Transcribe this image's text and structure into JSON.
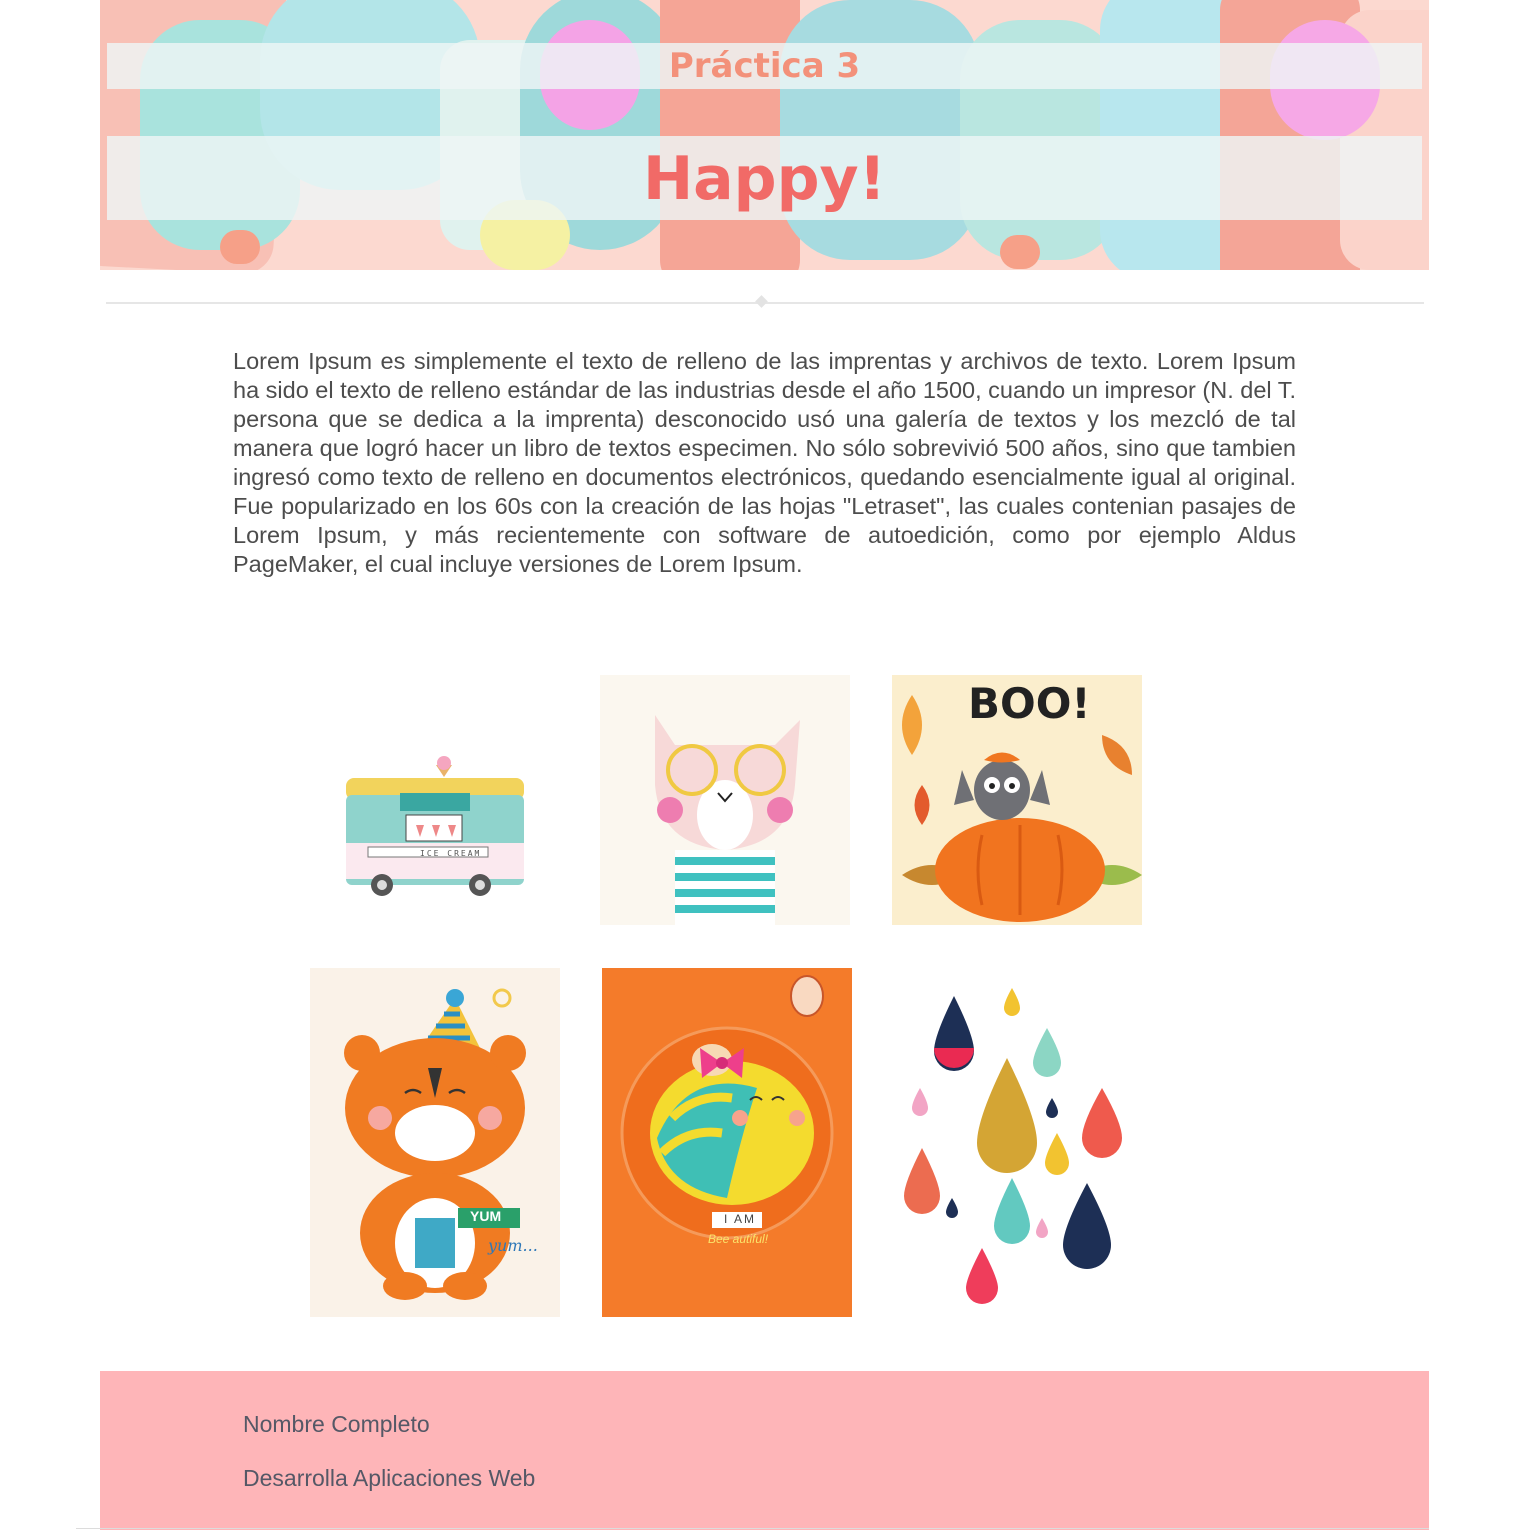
{
  "header": {
    "subtitle": "Práctica 3",
    "title": "Happy!"
  },
  "content": {
    "paragraph": "Lorem Ipsum es simplemente el texto de relleno de las imprentas y archivos de texto. Lorem Ipsum ha sido el texto de relleno estándar de las industrias desde el año 1500, cuando un impresor (N. del T. persona que se dedica a la imprenta) desconocido usó una galería de textos y los mezcló de tal manera que logró hacer un libro de textos especimen. No sólo sobrevivió 500 años, sino que tambien ingresó como texto de relleno en documentos electrónicos, quedando esencialmente igual al original. Fue popularizado en los 60s con la creación de las hojas \"Letraset\", las cuales contenian pasajes de Lorem Ipsum, y más recientemente con software de autoedición, como por ejemplo Aldus PageMaker, el cual incluye versiones de Lorem Ipsum."
  },
  "gallery": {
    "images": [
      {
        "name": "ice-cream-truck",
        "label": "ICE CREAM"
      },
      {
        "name": "cat-with-glasses"
      },
      {
        "name": "boo-bat-pumpkin",
        "label": "BOO!"
      },
      {
        "name": "tiger-party-hat",
        "label": "YUM",
        "label2": "yum..."
      },
      {
        "name": "bee-autiful",
        "label": "I AM",
        "label2": "Bee autiful!"
      },
      {
        "name": "raindrops-pattern"
      }
    ]
  },
  "footer": {
    "line1": "Nombre Completo",
    "line2": "Desarrolla Aplicaciones Web"
  },
  "colors": {
    "title": "#f16a67",
    "subtitle": "#f3917a",
    "footer_bg": "#feb5b8",
    "text": "#4d4d4d"
  }
}
